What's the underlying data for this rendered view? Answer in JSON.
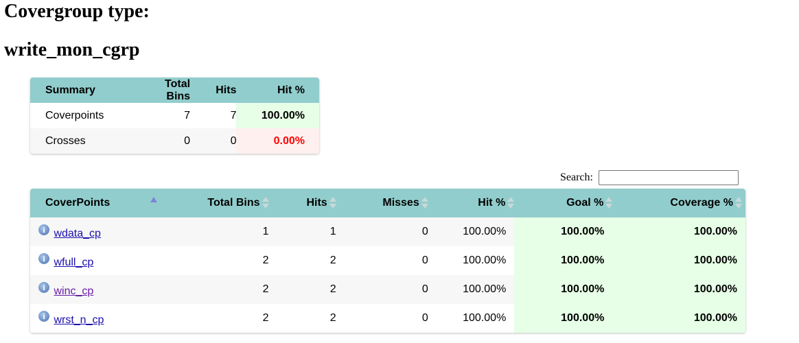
{
  "heading": {
    "type_label": "Covergroup type:",
    "type_name": "write_mon_cgrp"
  },
  "summary": {
    "headers": [
      "Summary",
      "Total Bins",
      "Hits",
      "Hit %"
    ],
    "rows": [
      {
        "name": "Coverpoints",
        "total_bins": "7",
        "hits": "7",
        "hit_pct": "100.00%"
      },
      {
        "name": "Crosses",
        "total_bins": "0",
        "hits": "0",
        "hit_pct": "0.00%"
      }
    ]
  },
  "search": {
    "label": "Search:",
    "value": ""
  },
  "coverpoints": {
    "headers": [
      "CoverPoints",
      "Total Bins",
      "Hits",
      "Misses",
      "Hit %",
      "Goal %",
      "Coverage %"
    ],
    "sorted_column": "CoverPoints",
    "sort_direction": "ascending",
    "info_icon": "info-icon",
    "rows": [
      {
        "name": "wdata_cp",
        "total_bins": "1",
        "hits": "1",
        "misses": "0",
        "hit_pct": "100.00%",
        "goal_pct": "100.00%",
        "coverage_pct": "100.00%"
      },
      {
        "name": "wfull_cp",
        "total_bins": "2",
        "hits": "2",
        "misses": "0",
        "hit_pct": "100.00%",
        "goal_pct": "100.00%",
        "coverage_pct": "100.00%"
      },
      {
        "name": "winc_cp",
        "total_bins": "2",
        "hits": "2",
        "misses": "0",
        "hit_pct": "100.00%",
        "goal_pct": "100.00%",
        "coverage_pct": "100.00%"
      },
      {
        "name": "wrst_n_cp",
        "total_bins": "2",
        "hits": "2",
        "misses": "0",
        "hit_pct": "100.00%",
        "goal_pct": "100.00%",
        "coverage_pct": "100.00%"
      }
    ]
  },
  "colors": {
    "header_bg": "#92cdcd",
    "good_bg": "#e6ffe6",
    "bad_bg": "#fff0f0",
    "bad_text": "#ff0000",
    "link": "#1a0dab",
    "visited_link": "#681da8"
  }
}
